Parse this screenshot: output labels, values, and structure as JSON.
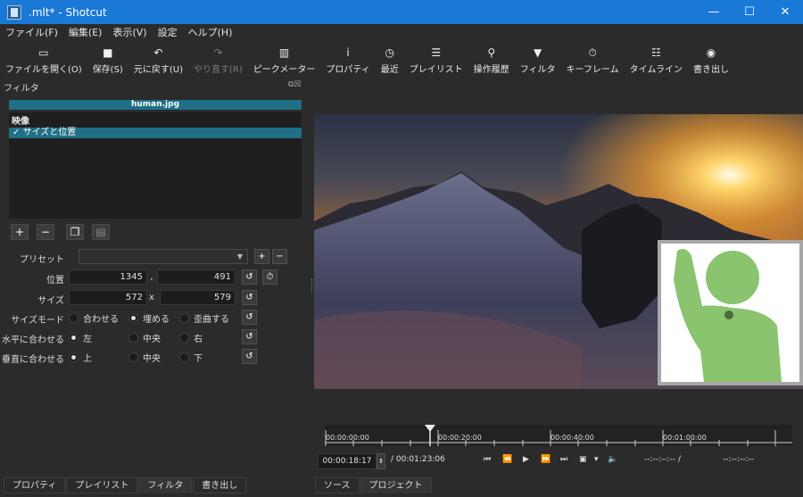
{
  "window": {
    "title": ".mlt* - Shotcut",
    "minimize": "—",
    "maximize": "☐",
    "close": "✕"
  },
  "menu": [
    "ファイル(F)",
    "編集(E)",
    "表示(V)",
    "設定",
    "ヘルプ(H)"
  ],
  "toolbar": [
    {
      "label": "ファイルを開く(O)",
      "icon": "open-folder-icon",
      "glyph": "▭",
      "enabled": true
    },
    {
      "label": "保存(S)",
      "icon": "save-icon",
      "glyph": "■",
      "enabled": true
    },
    {
      "label": "元に戻す(U)",
      "icon": "undo-icon",
      "glyph": "↶",
      "enabled": true
    },
    {
      "label": "やり直す(R)",
      "icon": "redo-icon",
      "glyph": "↷",
      "enabled": false
    },
    {
      "label": "ピークメーター",
      "icon": "peak-meter-icon",
      "glyph": "▥",
      "enabled": true
    },
    {
      "label": "プロパティ",
      "icon": "info-icon",
      "glyph": "i",
      "enabled": true
    },
    {
      "label": "最近",
      "icon": "clock-icon",
      "glyph": "◷",
      "enabled": true
    },
    {
      "label": "プレイリスト",
      "icon": "list-icon",
      "glyph": "☰",
      "enabled": true
    },
    {
      "label": "操作履歴",
      "icon": "history-icon",
      "glyph": "⚲",
      "enabled": true
    },
    {
      "label": "フィルタ",
      "icon": "filter-icon",
      "glyph": "▼",
      "enabled": true
    },
    {
      "label": "キーフレーム",
      "icon": "stopwatch-icon",
      "glyph": "⏱",
      "enabled": true
    },
    {
      "label": "タイムライン",
      "icon": "timeline-icon",
      "glyph": "☷",
      "enabled": true
    },
    {
      "label": "書き出し",
      "icon": "export-icon",
      "glyph": "◉",
      "enabled": true
    }
  ],
  "filters_panel": {
    "title": "フィルタ",
    "file": "human.jpg",
    "category": "映像",
    "items": [
      {
        "check": "✓",
        "label": "サイズと位置"
      }
    ],
    "buttons": {
      "add": "+",
      "remove": "−",
      "copy": "❐",
      "paste": "▤"
    }
  },
  "props": {
    "preset_label": "プリセット",
    "preset_value": "",
    "position_label": "位置",
    "pos_x": "1345",
    "pos_sep": ",",
    "pos_y": "491",
    "size_label": "サイズ",
    "size_w": "572",
    "size_sep": "x",
    "size_h": "579",
    "reset_glyph": "↺",
    "keyframe_glyph": "⏱",
    "size_mode_label": "サイズモード",
    "size_mode_options": [
      "合わせる",
      "埋める",
      "歪曲する"
    ],
    "size_mode_selected": 1,
    "halign_label": "水平に合わせる",
    "halign_options": [
      "左",
      "中央",
      "右"
    ],
    "halign_selected": 0,
    "valign_label": "垂直に合わせる",
    "valign_options": [
      "上",
      "中央",
      "下"
    ],
    "valign_selected": 0
  },
  "timeline": {
    "ticks": [
      "00:00:00:00",
      "00:00:20:00",
      "00:00:40:00",
      "00:01:00:00"
    ],
    "current": "00:00:18:17",
    "duration": "/ 00:01:23:06",
    "in_point": "--:--:--:-- /",
    "out_point": "--:--:--:--"
  },
  "transport": [
    "⏮",
    "⏪",
    "▶",
    "⏩",
    "⏭",
    "▣",
    "▾",
    "🔈"
  ],
  "tabs_left": [
    "プロパティ",
    "プレイリスト",
    "フィルタ",
    "書き出し"
  ],
  "tabs_left_active": 2,
  "tabs_right": [
    "ソース",
    "プロジェクト"
  ],
  "colors": {
    "titlebar": "#1a78d6",
    "selection": "#1f6f86",
    "figure": "#8ac46e"
  }
}
